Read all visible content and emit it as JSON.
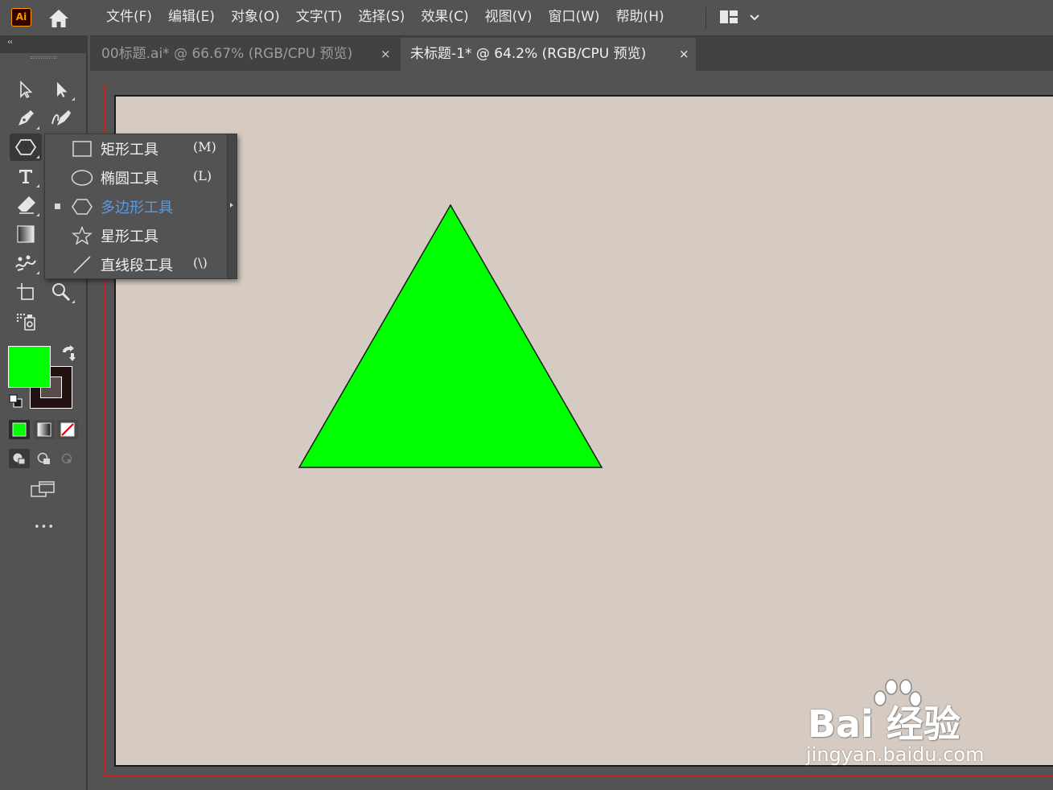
{
  "app": {
    "logo_text": "Ai",
    "accent_color": "#ff9a00"
  },
  "menubar": {
    "items": [
      "文件(F)",
      "编辑(E)",
      "对象(O)",
      "文字(T)",
      "选择(S)",
      "效果(C)",
      "视图(V)",
      "窗口(W)",
      "帮助(H)"
    ],
    "home_icon": "home-icon",
    "workspace_icon": "workspace-layout-icon"
  },
  "tabs": [
    {
      "label": "00标题.ai* @ 66.67% (RGB/CPU 预览)",
      "active": false,
      "close": "×"
    },
    {
      "label": "未标题-1* @ 64.2% (RGB/CPU 预览)",
      "active": true,
      "close": "×"
    }
  ],
  "toolbar": {
    "collapse_label": "‹‹",
    "tools": [
      "selection-tool",
      "direct-selection-tool",
      "pen-tool",
      "curvature-tool",
      "polygon-tool",
      "type-tool",
      "eraser-tool",
      "gradient-tool",
      "puppet-warp-tool",
      "artboard-tool",
      "zoom-tool",
      "symbol-sprayer-tool"
    ],
    "fill_color": "#00ff00",
    "stroke_color": "#221212",
    "more_label": "•••"
  },
  "flyout": {
    "items": [
      {
        "label": "矩形工具",
        "shortcut": "(M)",
        "icon": "rectangle-icon",
        "selected": false
      },
      {
        "label": "椭圆工具",
        "shortcut": "(L)",
        "icon": "ellipse-icon",
        "selected": false
      },
      {
        "label": "多边形工具",
        "shortcut": "",
        "icon": "polygon-icon",
        "selected": true
      },
      {
        "label": "星形工具",
        "shortcut": "",
        "icon": "star-icon",
        "selected": false
      },
      {
        "label": "直线段工具",
        "shortcut": "(\\)",
        "icon": "line-segment-icon",
        "selected": false
      }
    ]
  },
  "canvas": {
    "artboard_color": "#d6cbc2",
    "triangle_fill": "#00ff00",
    "triangle_stroke": "#1a1a1a"
  },
  "watermark": {
    "brand": "Bai 经验",
    "url": "jingyan.baidu.com"
  }
}
